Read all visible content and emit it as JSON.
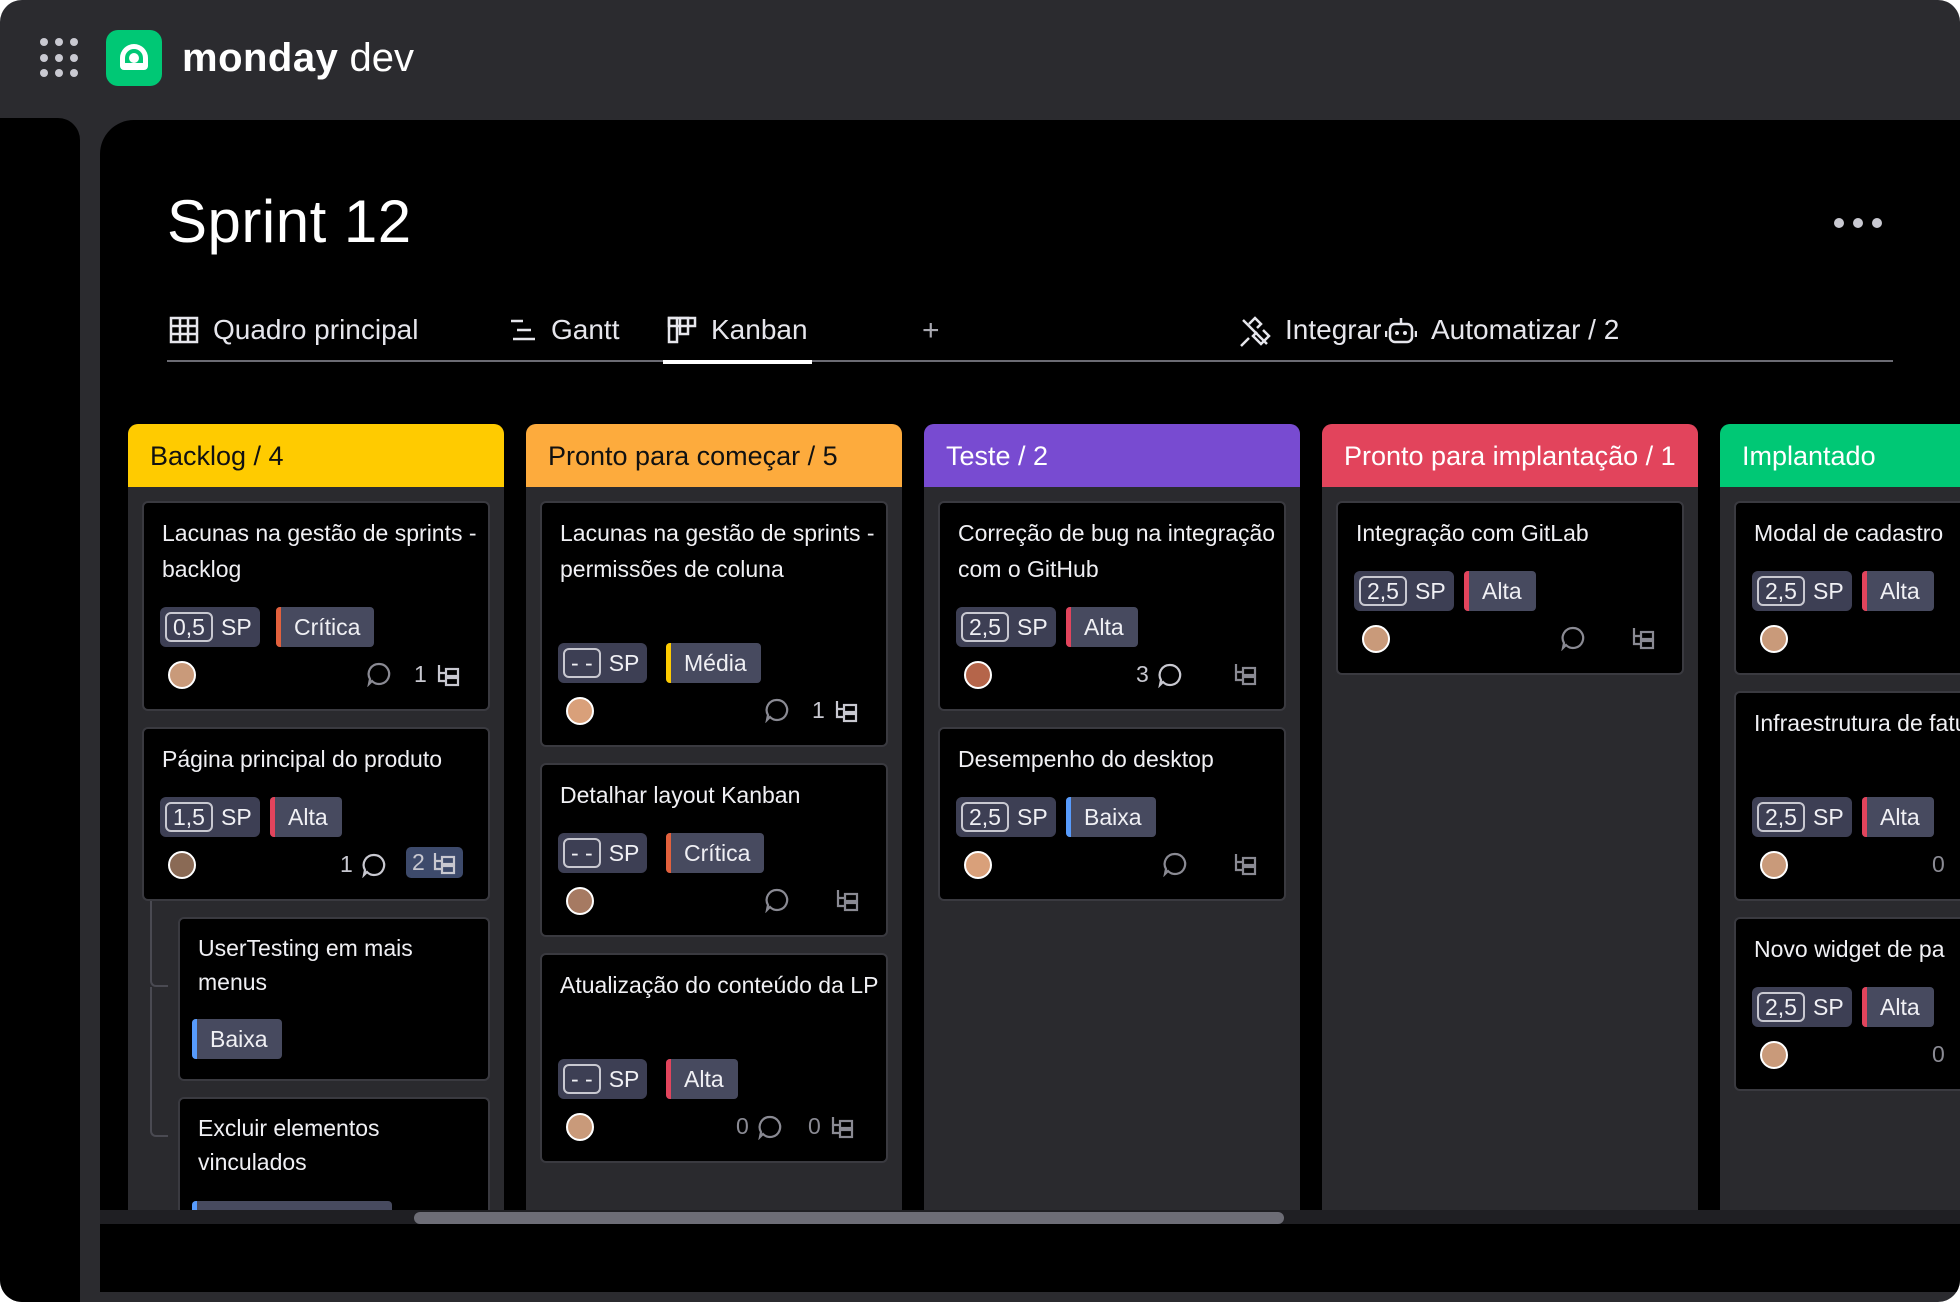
{
  "app": {
    "brand_bold": "monday",
    "brand_light": " dev"
  },
  "page": {
    "title": "Sprint 12"
  },
  "tabs": [
    {
      "label": "Quadro principal",
      "icon": "table-icon"
    },
    {
      "label": "Gantt",
      "icon": "gantt-icon"
    },
    {
      "label": "Kanban",
      "icon": "kanban-icon",
      "active": true
    }
  ],
  "tab_add": "+",
  "actions": {
    "integrate": "Integrar",
    "automate": "Automatizar / 2"
  },
  "colors": {
    "backlog": "#ffcb00",
    "ready": "#fdab3d",
    "test": "#784bd1",
    "deploy_ready": "#e2445c",
    "deployed": "#00c875",
    "critica": "#e2603c",
    "alta": "#e2445c",
    "media": "#fdcb00",
    "baixa": "#579bfc"
  },
  "columns": [
    {
      "header": "Backlog / 4",
      "cards": [
        {
          "title": "Lacunas na gestão de sprints - backlog",
          "sp": "0,5",
          "sp_label": "SP",
          "priority": "Crítica",
          "comments": "",
          "subitems": "1"
        },
        {
          "title": "Página principal do produto",
          "sp": "1,5",
          "sp_label": "SP",
          "priority": "Alta",
          "comments": "1",
          "subitems": "2"
        }
      ],
      "subcards": [
        {
          "title": "UserTesting em mais menus",
          "priority": "Baixa"
        },
        {
          "title": "Excluir elementos vinculados",
          "priority": ""
        }
      ]
    },
    {
      "header": "Pronto para começar / 5",
      "cards": [
        {
          "title": "Lacunas na gestão de sprints - permissões de coluna",
          "sp": "- -",
          "sp_label": "SP",
          "priority": "Média",
          "comments": "",
          "subitems": "1"
        },
        {
          "title": "Detalhar layout Kanban",
          "sp": "- -",
          "sp_label": "SP",
          "priority": "Crítica",
          "comments": "",
          "subitems": ""
        },
        {
          "title": "Atualização do conteúdo da LP",
          "sp": "- -",
          "sp_label": "SP",
          "priority": "Alta",
          "comments": "0",
          "subitems": "0"
        }
      ]
    },
    {
      "header": "Teste / 2",
      "cards": [
        {
          "title": "Correção de bug na integração com o GitHub",
          "sp": "2,5",
          "sp_label": "SP",
          "priority": "Alta",
          "comments": "3",
          "subitems": ""
        },
        {
          "title": "Desempenho do desktop",
          "sp": "2,5",
          "sp_label": "SP",
          "priority": "Baixa",
          "comments": "",
          "subitems": ""
        }
      ]
    },
    {
      "header": "Pronto para implantação / 1",
      "cards": [
        {
          "title": "Integração com GitLab",
          "sp": "2,5",
          "sp_label": "SP",
          "priority": "Alta",
          "comments": "",
          "subitems": ""
        }
      ]
    },
    {
      "header": "Implantado",
      "cards": [
        {
          "title": "Modal de cadastro",
          "sp": "2,5",
          "sp_label": "SP",
          "priority": "Alta",
          "comments": "",
          "subitems": ""
        },
        {
          "title": "Infraestrutura de faturamento",
          "sp": "2,5",
          "sp_label": "SP",
          "priority": "Alta",
          "comments": "0",
          "subitems": ""
        },
        {
          "title": "Novo widget de pa",
          "sp": "2,5",
          "sp_label": "SP",
          "priority": "Alta",
          "comments": "0",
          "subitems": ""
        }
      ]
    }
  ]
}
